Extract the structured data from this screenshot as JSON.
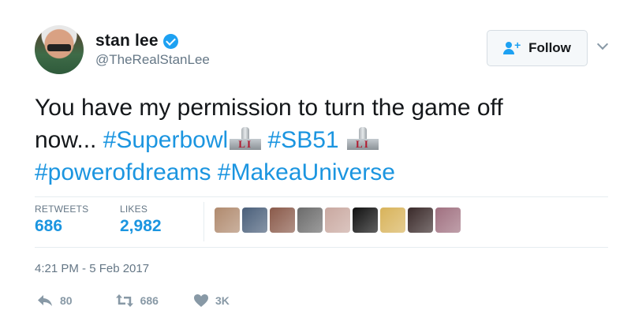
{
  "user": {
    "display_name": "stan lee",
    "handle": "@TheRealStanLee",
    "verified": true
  },
  "follow_button": {
    "label": "Follow",
    "icon": "add-user-icon"
  },
  "tweet": {
    "line1": "You have my permission to turn the game off",
    "line2_text": "now... ",
    "hashtag_superbowl": "#Superbowl",
    "hashtag_sb51": "#SB51",
    "emoji_label": "LI",
    "hashtag_powerofdreams": "#powerofdreams",
    "hashtag_makeauniverse": "#MakeaUniverse"
  },
  "stats": {
    "retweets_label": "RETWEETS",
    "retweets_value": "686",
    "likes_label": "LIKES",
    "likes_value": "2,982"
  },
  "likers": [
    "#b08a6e",
    "#4a5f7a",
    "#8a5a4a",
    "#6b6b6b",
    "#c9a8a0",
    "#111111",
    "#d8b35a",
    "#3a2a2a",
    "#a07080"
  ],
  "timestamp": "4:21 PM - 5 Feb 2017",
  "actions": {
    "reply_count": "80",
    "retweet_count": "686",
    "like_count": "3K"
  },
  "colors": {
    "link": "#1b95e0",
    "verified": "#1da1f2",
    "muted": "#657786",
    "action_gray": "#8899a6"
  }
}
